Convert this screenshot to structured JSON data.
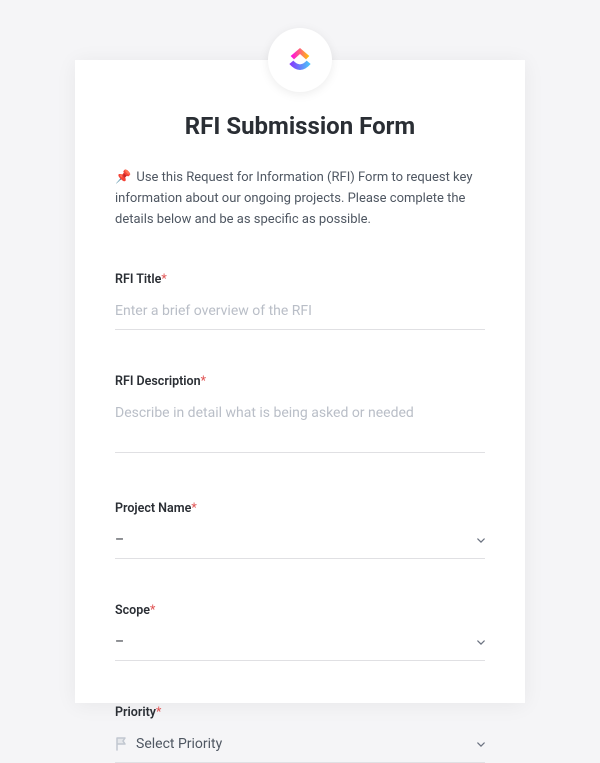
{
  "form": {
    "title": "RFI Submission Form",
    "intro_pin": "📌",
    "intro_text": "Use this Request for Information (RFI) Form to request key information about our ongoing projects. Please complete the details below and be as specific as possible.",
    "fields": {
      "rfi_title": {
        "label": "RFI Title",
        "required_mark": "*",
        "placeholder": "Enter a brief overview of the RFI"
      },
      "rfi_description": {
        "label": "RFI Description",
        "required_mark": "*",
        "placeholder": "Describe in detail what is being asked or needed"
      },
      "project_name": {
        "label": "Project Name",
        "required_mark": "*",
        "value": "–"
      },
      "scope": {
        "label": "Scope",
        "required_mark": "*",
        "value": "–"
      },
      "priority": {
        "label": "Priority",
        "required_mark": "*",
        "placeholder": "Select Priority"
      }
    }
  }
}
